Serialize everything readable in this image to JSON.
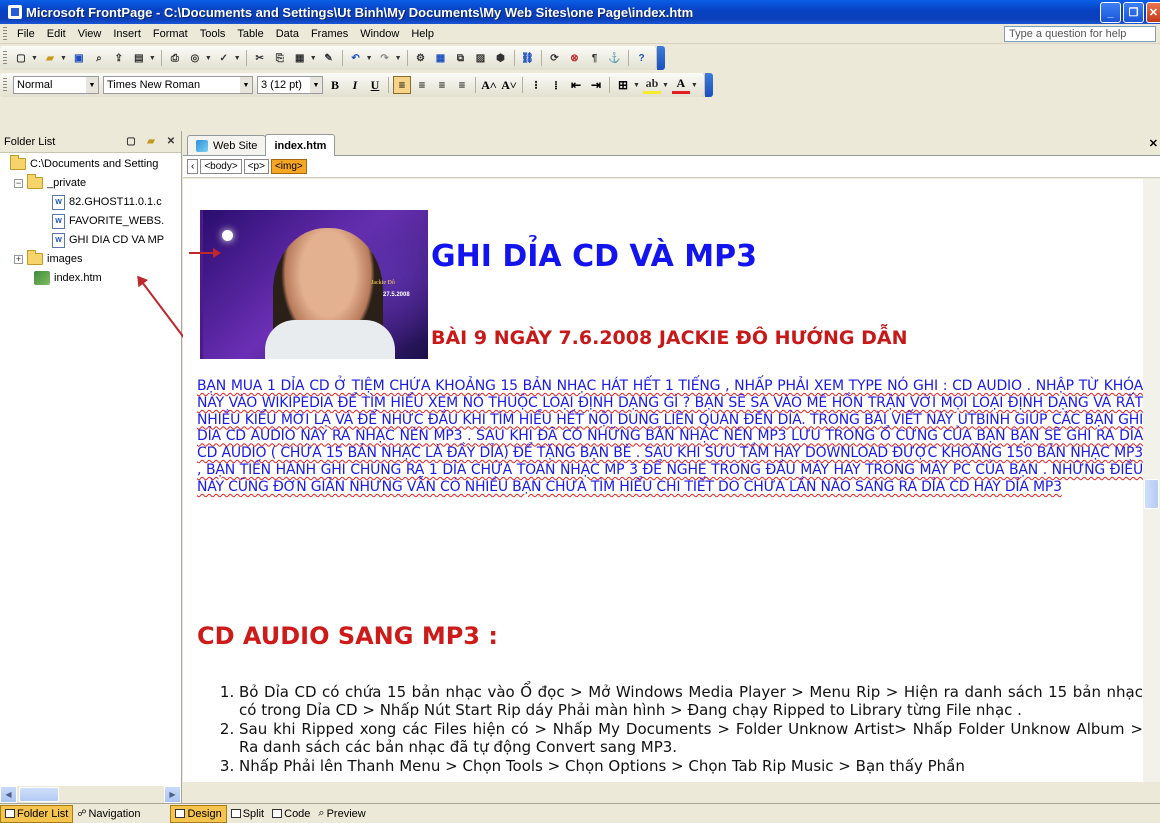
{
  "window": {
    "title": "Microsoft FrontPage - C:\\Documents and Settings\\Ut Binh\\My Documents\\My Web Sites\\one Page\\index.htm"
  },
  "menu": {
    "items": [
      "File",
      "Edit",
      "View",
      "Insert",
      "Format",
      "Tools",
      "Table",
      "Data",
      "Frames",
      "Window",
      "Help"
    ],
    "help_placeholder": "Type a question for help"
  },
  "format_toolbar": {
    "style": "Normal",
    "font": "Times New Roman",
    "size": "3 (12 pt)"
  },
  "folder_list": {
    "title": "Folder List",
    "root": "C:\\Documents and Setting",
    "private_folder": "_private",
    "files": [
      "82.GHOST11.0.1.c",
      "FAVORITE_WEBS.",
      "GHI DIA CD VA MP"
    ],
    "images_folder": "images",
    "index_file": "index.htm"
  },
  "tabs": {
    "website": "Web Site",
    "current": "index.htm"
  },
  "tags": [
    "<body>",
    "<p>",
    "<img>"
  ],
  "page": {
    "photo_sig": "Jackie Đô",
    "photo_date": "27.5.2008",
    "heading": "GHI DỈA CD VÀ MP3",
    "subheading": "BÀI 9 NGÀY 7.6.2008 JACKIE ĐÔ HƯỚNG DẪN",
    "paragraph": "BẠN MUA 1 DỈA CD Ở TIỆM CHỨA KHOẢNG 15 BẢN NHẠC HÁT HẾT 1 TIẾNG , NHẤP PHẢI XEM TYPE NÓ GHI : CD AUDIO . NHẬP TỪ KHÓA NÀY VÀO WIKIPEDIA ĐỂ TÌM HIỂU XEM NÓ THUỘC LOẠI ĐỊNH DẠNG GÌ ? BẠN SẼ SA VÀO MÊ HỒN TRẬN VỚI MỌI LOẠI ĐỊNH DẠNG VÀ RẤT NHIỀU KIỂU MỚI LẠ VÀ ĐỂ NHỨC ĐẦU KHI TÌM HIỂU HẾT NỘI DUNG LIÊN QUAN ĐẾN DỈA. TRONG BÀI VIẾT NÀY UTBINH GIÚP CÁC BẠN GHI DỈA CD AUDIO NÀY RA NHẠC NÉN MP3 . SAU KHI ĐÃ CÓ NHỮNG BẢN NHẠC NÉN MP3 LƯU TRONG Ổ CỨNG CỦA BẠN BẠN SẼ GHI RA DỈA CD AUDIO ( CHỨA 15 BẢN NHẠC LÀ ĐẦY DỈA) ĐỂ TẶNG BẠN BÈ . SAU KHI SƯU TẦM HAY DOWNLOAD ĐƯỢC KHOẢNG 150 BẢN NHẠC MP3 , BẠN TIẾN HÀNH GHI CHÚNG RA 1 DỈA CHỨA TOÀN NHẠC MP 3 ĐỂ NGHE TRONG ĐẦU MÁY HAY TRONG MÁY PC CỦA BẠN . NHỮNG ĐIỀU NÀY CŨNG ĐƠN GIẢN NHƯNG VẪN CÓ NHIỀU BẠN CHƯA TÌM HIỂU CHI TIẾT DO CHƯA LẦN NÀO SANG RA DỈA CD HAY DỈA MP3",
    "section_title": "CD AUDIO SANG MP3 :",
    "steps": [
      "Bỏ Dỉa CD có chứa 15 bản nhạc vào Ổ đọc > Mở Windows Media Player > Menu Rip > Hiện ra danh sách 15 bản nhạc có trong Dỉa CD > Nhấp Nút Start Rip dáy Phải màn hình > Đang chạy Ripped to Library từng File nhạc .",
      "Sau khi Ripped xong các Files hiện có > Nhấp My Documents > Folder Unknow Artist> Nhấp Folder Unknow Album > Ra danh sách các bản nhạc đã tự động Convert sang MP3.",
      "Nhấp Phải lên Thanh Menu > Chọn Tools > Chọn Options > Chọn Tab Rip Music > Bạn thấy Phần"
    ]
  },
  "bottom": {
    "folder_list": "Folder List",
    "navigation": "Navigation",
    "design": "Design",
    "split": "Split",
    "code": "Code",
    "preview": "Preview"
  }
}
